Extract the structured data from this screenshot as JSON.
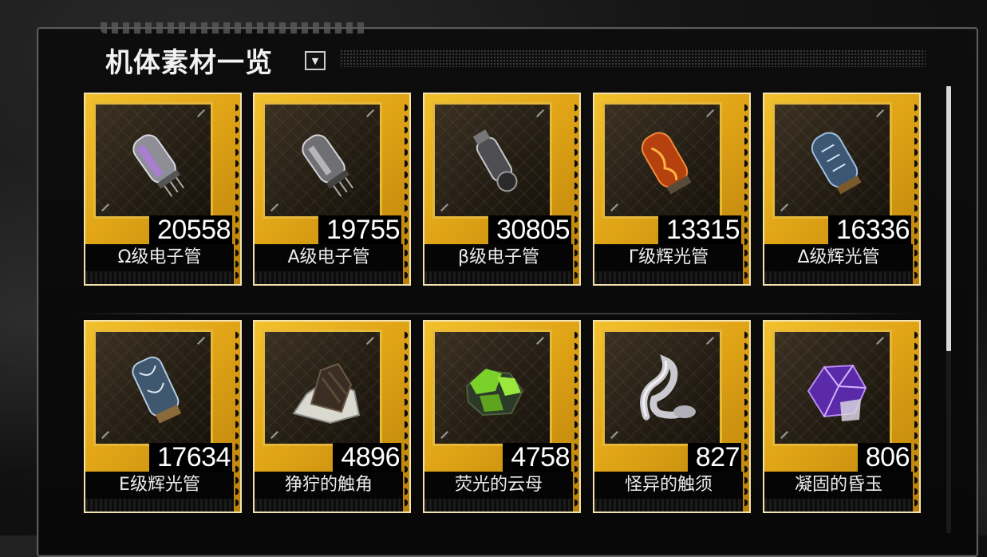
{
  "panel": {
    "title": "机体素材一览",
    "toggle_icon": "chevron-down-icon"
  },
  "items": [
    {
      "name": "Ω级电子管",
      "count": "20558",
      "icon": "vacuum-tube-omega-icon"
    },
    {
      "name": "A级电子管",
      "count": "19755",
      "icon": "vacuum-tube-alpha-icon"
    },
    {
      "name": "β级电子管",
      "count": "30805",
      "icon": "vacuum-tube-beta-icon"
    },
    {
      "name": "Γ级辉光管",
      "count": "13315",
      "icon": "glow-tube-gamma-icon"
    },
    {
      "name": "Δ级辉光管",
      "count": "16336",
      "icon": "glow-tube-delta-icon"
    },
    {
      "name": "E级辉光管",
      "count": "17634",
      "icon": "glow-tube-epsilon-icon"
    },
    {
      "name": "狰狞的触角",
      "count": "4896",
      "icon": "grim-antenna-icon"
    },
    {
      "name": "荧光的云母",
      "count": "4758",
      "icon": "fluorescent-mica-icon"
    },
    {
      "name": "怪异的触须",
      "count": "827",
      "icon": "weird-tentacle-icon"
    },
    {
      "name": "凝固的昏玉",
      "count": "806",
      "icon": "solidified-gem-icon"
    }
  ],
  "colors": {
    "card_gold": "#e0a416",
    "panel_border": "#5a5a5a"
  }
}
